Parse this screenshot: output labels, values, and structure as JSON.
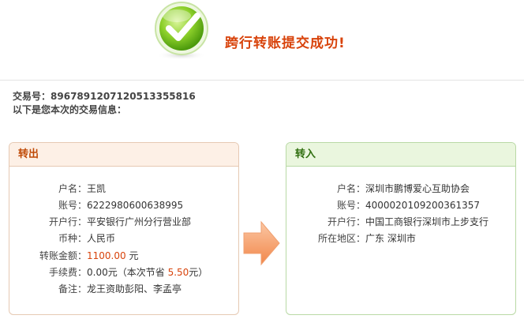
{
  "header": {
    "title": "跨行转账提交成功!",
    "icon": "check-success-icon"
  },
  "transaction": {
    "number_label": "交易号：",
    "number": "89678912071205133558l6",
    "info_text": "以下是您本次的交易信息："
  },
  "out_panel": {
    "title": "转出",
    "fields": {
      "name_label": "户名：",
      "name": "王凯",
      "account_label": "账号：",
      "account": "6222980600638995",
      "bank_label": "开户行：",
      "bank": "平安银行广州分行营业部",
      "currency_label": "币种：",
      "currency": "人民币",
      "amount_label": "转账金额：",
      "amount": "1100.00",
      "amount_unit": "元",
      "fee_label": "手续费：",
      "fee": "0.00元",
      "saving_prefix": "（本次节省",
      "saving": "5.50",
      "saving_suffix": "元）",
      "note_label": "备注：",
      "note": "龙王资助彭阳、李孟亭"
    }
  },
  "in_panel": {
    "title": "转入",
    "fields": {
      "name_label": "户名：",
      "name": "深圳市鹏博爱心互助协会",
      "account_label": "账号：",
      "account": "4000020109200361357",
      "bank_label": "开户行：",
      "bank": "中国工商银行深圳市上步支行",
      "region_label": "所在地区：",
      "region": "广东 深圳市"
    }
  },
  "colors": {
    "accent_orange": "#d8430b",
    "success_green": "#4a9a12",
    "out_border": "#e6c9b3",
    "in_border": "#b9d9a5"
  }
}
